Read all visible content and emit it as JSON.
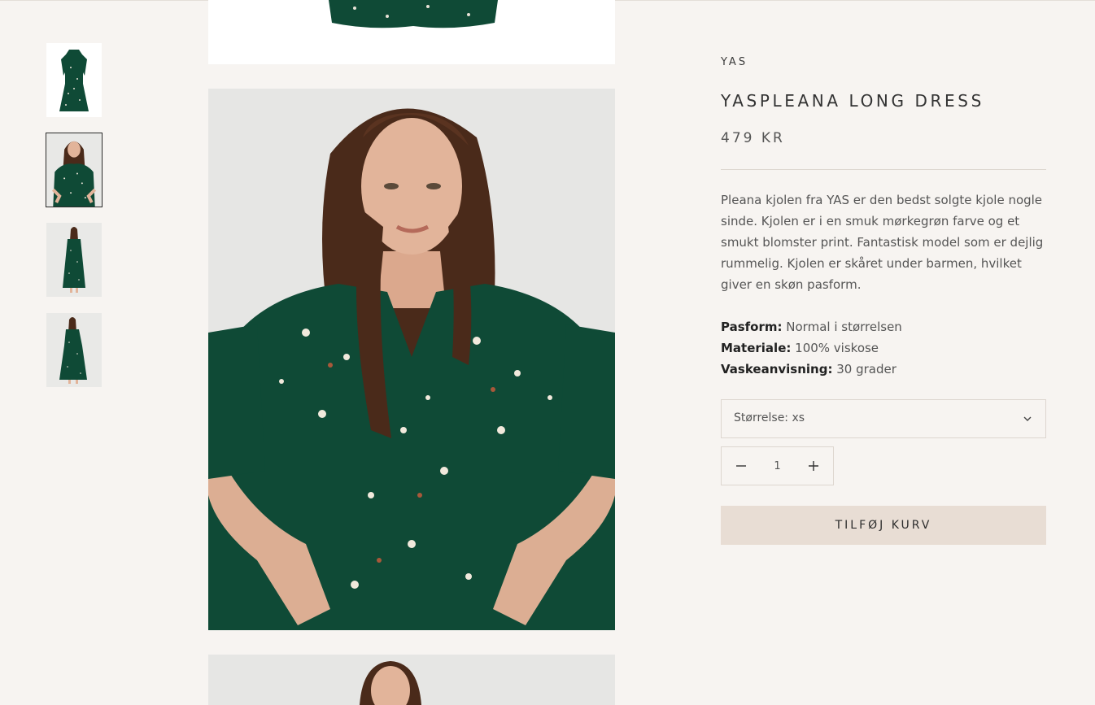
{
  "product": {
    "brand": "YAS",
    "title": "YASPLEANA LONG DRESS",
    "price": "479 KR",
    "description": "Pleana kjolen fra YAS er den bedst solgte kjole nogle sinde. Kjolen er i en smuk mørkegrøn farve og et smukt blomster print. Fantastisk model som er dejlig rummelig. Kjolen er skåret under barmen, hvilket giver en skøn pasform.",
    "specs": [
      {
        "label": "Pasform:",
        "value": "Normal i størrelsen"
      },
      {
        "label": "Materiale:",
        "value": "100% viskose"
      },
      {
        "label": "Vaskeanvisning:",
        "value": "30 grader"
      }
    ],
    "size_selector": {
      "label": "Størrelse: xs"
    },
    "quantity": {
      "value": "1"
    },
    "add_to_cart_label": "TILFØJ KURV"
  },
  "colors": {
    "background": "#f7f4f1",
    "dress_green": "#0f4a36",
    "button_bg": "#e8ddd4",
    "divider": "#ddd6cf"
  },
  "gallery": {
    "thumbnails": [
      "dress-flat-lay",
      "model-closeup",
      "model-full-front",
      "model-full-angle"
    ],
    "active_index": 1
  }
}
